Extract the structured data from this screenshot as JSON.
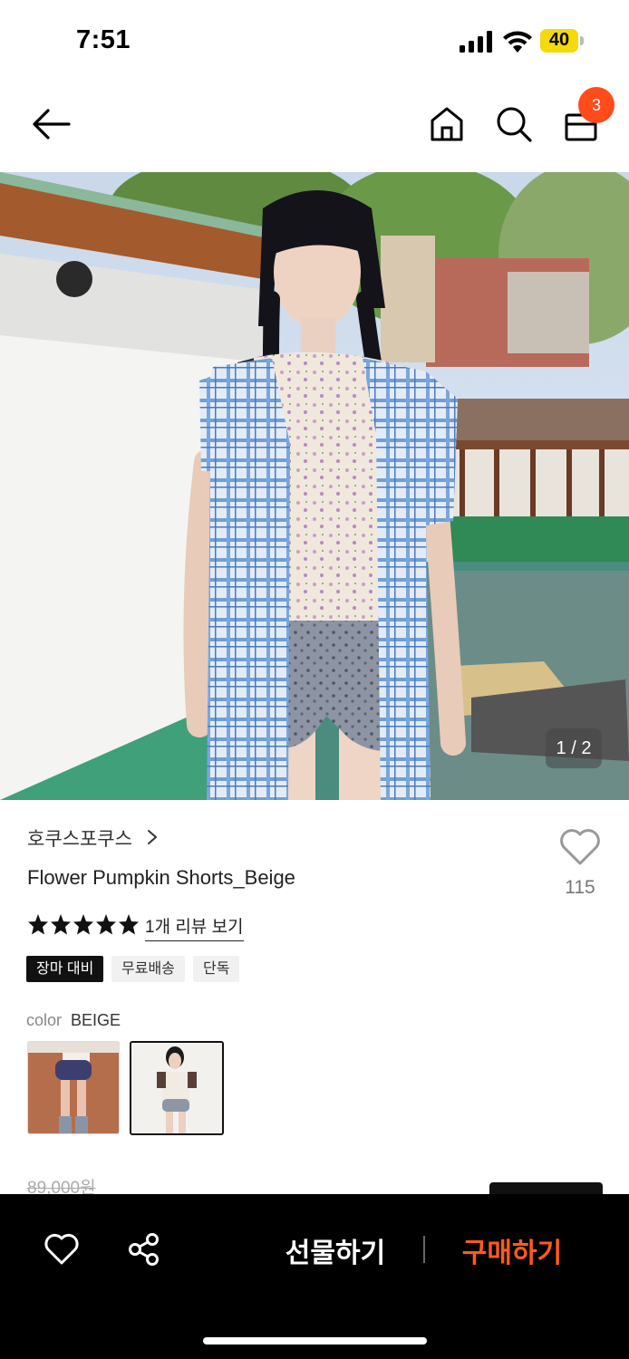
{
  "status_bar": {
    "time": "7:51",
    "battery": "40"
  },
  "nav": {
    "cart_count": "3"
  },
  "hero": {
    "counter": "1 / 2"
  },
  "product": {
    "brand": "호쿠스포쿠스",
    "name": "Flower Pumpkin Shorts_Beige",
    "like_count": "115",
    "rating": 5,
    "review_link": "1개 리뷰 보기",
    "tags": [
      "장마 대비",
      "무료배송",
      "단독"
    ],
    "color_label": "color",
    "color_value": "BEIGE",
    "original_price": "89,000원"
  },
  "bottom_bar": {
    "gift_label": "선물하기",
    "buy_label": "구매하기"
  },
  "colors": {
    "accent": "#ff5a1f",
    "badge": "#ff4c1a",
    "bar": "#000000"
  }
}
